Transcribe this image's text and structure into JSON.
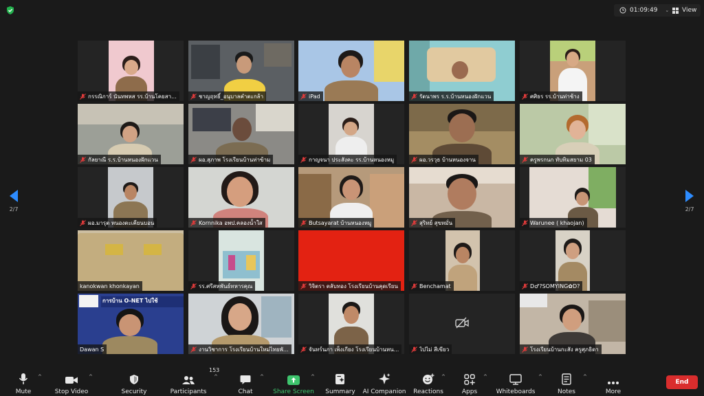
{
  "top": {
    "timer": "01:09:49",
    "view_label": "View"
  },
  "pager": {
    "left_page": "2/7",
    "right_page": "2/7"
  },
  "participants": [
    "กรรณิการ์ นันทพหส รร.บ้านโคยสา...",
    "ชาญฤทธิ์_อนุบาลคำตะกล้า",
    "iPad",
    "รัตนาพร ร.ร.บ้านหนองฝักแวน",
    "ศศิธร รร.บ้านท่าช้าง",
    "กัลยาณี ร.ร.บ้านหนองฝักแวน",
    "ผอ.สุภาพ โรงเรียนบ้านท่าข้าม",
    "กาญจนา  ประสังคะ รร.บ้านหนองหมู",
    "ผอ.วรวุธ บ้านหนองจาน",
    "ครูพรกนก ทับทิมสยาม 03",
    "ผอ.มารุต หนองตะเคียนบอน",
    "Kornnika อพป.คลองน้ำใส",
    "Butsayarat บ้านหนองหมู",
    "สุริทย์  สุขหมั่น",
    "Warunee ( khaojan)",
    "kanokwan khonkayan",
    "รร.ศรีสหพันธ์ทหารคุณ",
    "วิจิตรา ตลับทอง โรงเรียนบ้านคุดเรียน",
    "Benchamat",
    "D♂?SOMYING✿D?",
    "Dawan S",
    "งานวิชาการ โรงเรียนบ้านใหม่ไทยพั...",
    "จันทร์นภา เพ็งเกียง โรงเรียนบ้านหน...",
    "ไปไม่ สีเขียว",
    "โรงเรียนบ้านกะสัง ครูศุภธิดา"
  ],
  "tile_banner_text": "การบ้าน O-NET ไปใช้",
  "toolbar": {
    "mute": "Mute",
    "stop_video": "Stop Video",
    "security": "Security",
    "participants": "Participants",
    "participants_count": "153",
    "chat": "Chat",
    "share_screen": "Share Screen",
    "summary": "Summary",
    "ai_companion": "AI Companion",
    "reactions": "Reactions",
    "apps": "Apps",
    "whiteboards": "Whiteboards",
    "notes": "Notes",
    "more": "More",
    "end": "End"
  },
  "colors": {
    "background": "#1a1a1a",
    "accent_blue": "#2d8cff",
    "share_green": "#3ec46d",
    "end_red": "#d92d2d",
    "muted_red": "#e03b3b"
  },
  "icons": [
    "shield-check-icon",
    "clock-icon",
    "grid-view-icon",
    "arrow-left-icon",
    "arrow-right-icon",
    "mic-muted-icon",
    "microphone-icon",
    "video-camera-icon",
    "shield-icon",
    "people-icon",
    "chat-bubble-icon",
    "share-screen-icon",
    "summary-icon",
    "sparkle-icon",
    "emoji-icon",
    "apps-icon",
    "whiteboard-icon",
    "notes-icon",
    "more-dots-icon",
    "camera-off-icon"
  ]
}
